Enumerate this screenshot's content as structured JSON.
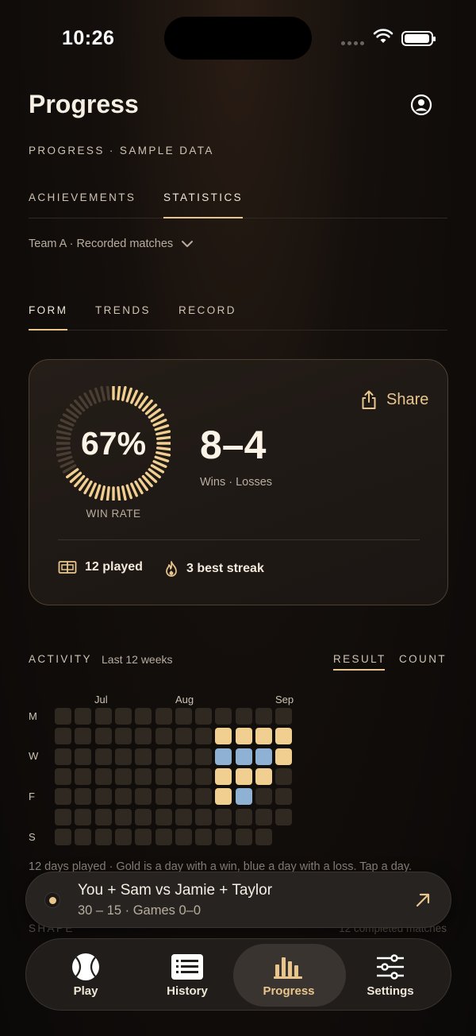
{
  "status": {
    "time": "10:26"
  },
  "header": {
    "title": "Progress",
    "subtitle": "PROGRESS · SAMPLE DATA"
  },
  "tabs_main": [
    {
      "label": "ACHIEVEMENTS",
      "active": false
    },
    {
      "label": "STATISTICS",
      "active": true
    }
  ],
  "filter": {
    "label": "Team A · Recorded matches"
  },
  "tabs_sub": [
    {
      "label": "FORM",
      "active": true
    },
    {
      "label": "TRENDS",
      "active": false
    },
    {
      "label": "RECORD",
      "active": false
    }
  ],
  "summary": {
    "win_rate": "67%",
    "win_rate_value": 0.67,
    "win_rate_label": "WIN RATE",
    "score": "8–4",
    "score_label": "Wins · Losses",
    "share_label": "Share",
    "played": "12 played",
    "streak": "3 best streak"
  },
  "activity": {
    "label": "ACTIVITY",
    "range": "Last 12 weeks",
    "tabs": [
      {
        "label": "RESULT",
        "active": true
      },
      {
        "label": "COUNT",
        "active": false
      }
    ],
    "months": [
      "Jul",
      "Aug",
      "Sep"
    ],
    "days": [
      "M",
      "W",
      "F",
      "S"
    ],
    "grid": [
      "-------",
      "-------",
      "-------",
      "-------",
      "-------",
      "-------",
      "-------",
      "-------",
      "-wlww--",
      "-wlwl--",
      "-wlw---",
      "-ww----"
    ],
    "legend": "12 days played · Gold is a day with a win, blue a day with a loss. Tap a day."
  },
  "shape": {
    "label": "SHAPE",
    "count": "12 completed matches"
  },
  "now_playing": {
    "title": "You + Sam vs Jamie + Taylor",
    "subtitle": "30 – 15  ·  Games 0–0"
  },
  "tabbar": [
    {
      "label": "Play",
      "icon": "tennis-ball-icon",
      "active": false
    },
    {
      "label": "History",
      "icon": "list-icon",
      "active": false
    },
    {
      "label": "Progress",
      "icon": "bar-chart-icon",
      "active": true
    },
    {
      "label": "Settings",
      "icon": "sliders-icon",
      "active": false
    }
  ],
  "colors": {
    "accent": "#e8c58d",
    "win": "#f0cf91",
    "loss": "#8fb1d4",
    "empty": "#2f2921"
  }
}
